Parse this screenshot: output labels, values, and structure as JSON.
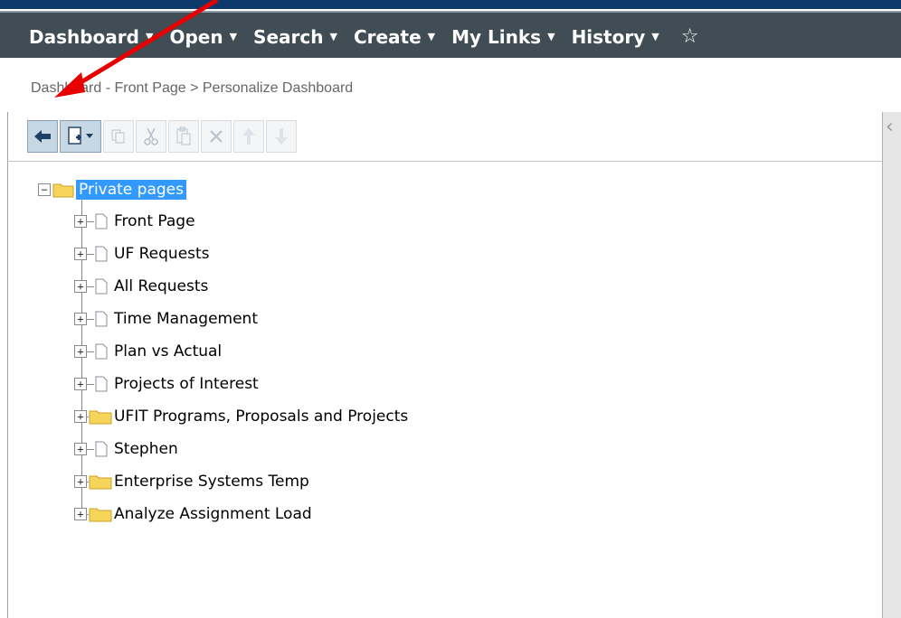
{
  "navbar": {
    "items": [
      {
        "label": "Dashboard"
      },
      {
        "label": "Open"
      },
      {
        "label": "Search"
      },
      {
        "label": "Create"
      },
      {
        "label": "My Links"
      },
      {
        "label": "History"
      }
    ],
    "star_icon": "star-outline-icon"
  },
  "breadcrumb": "Dashboard - Front Page > Personalize Dashboard",
  "toolbar": {
    "buttons": [
      "back-arrow-icon",
      "new-page-icon",
      "copy-icon",
      "cut-icon",
      "paste-icon",
      "delete-icon",
      "move-up-icon",
      "move-down-icon"
    ]
  },
  "tree": {
    "root": "Private pages",
    "children": [
      {
        "label": "Front Page",
        "type": "page"
      },
      {
        "label": "UF Requests",
        "type": "page"
      },
      {
        "label": "All Requests",
        "type": "page"
      },
      {
        "label": "Time Management",
        "type": "page"
      },
      {
        "label": "Plan vs Actual",
        "type": "page"
      },
      {
        "label": "Projects of Interest",
        "type": "page"
      },
      {
        "label": "UFIT Programs, Proposals and Projects",
        "type": "folder"
      },
      {
        "label": "Stephen",
        "type": "page"
      },
      {
        "label": "Enterprise Systems Temp",
        "type": "folder"
      },
      {
        "label": "Analyze Assignment Load",
        "type": "folder"
      }
    ]
  },
  "colors": {
    "navbar": "#414d55",
    "selection": "#3399ff",
    "annotation_arrow": "#e60000"
  }
}
